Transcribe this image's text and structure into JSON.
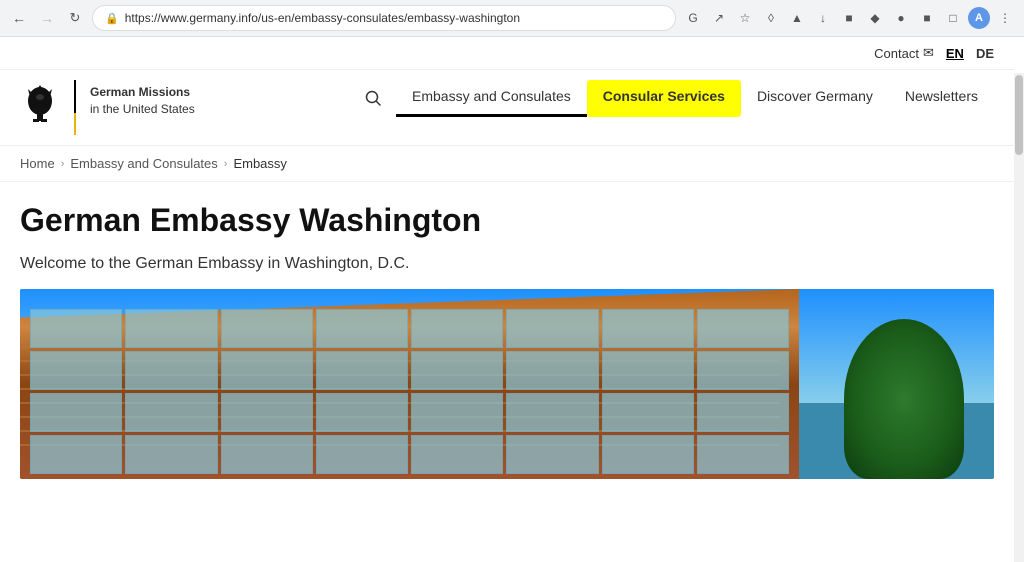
{
  "browser": {
    "url": "https://www.germany.info/us-en/embassy-consulates/embassy-washington",
    "back_disabled": false,
    "forward_disabled": true
  },
  "utility_bar": {
    "contact_label": "Contact",
    "lang_en": "EN",
    "lang_de": "DE",
    "active_lang": "EN"
  },
  "logo": {
    "org_name": "German Missions",
    "org_subtitle": "in the United States"
  },
  "nav": {
    "items": [
      {
        "label": "Embassy and Consulates",
        "active_underline": true,
        "highlighted": false
      },
      {
        "label": "Consular Services",
        "active_underline": false,
        "highlighted": true
      },
      {
        "label": "Discover Germany",
        "active_underline": false,
        "highlighted": false
      },
      {
        "label": "Newsletters",
        "active_underline": false,
        "highlighted": false
      }
    ],
    "search_icon": "🔍"
  },
  "breadcrumb": {
    "items": [
      {
        "label": "Home",
        "link": true
      },
      {
        "label": "Embassy and Consulates",
        "link": true
      },
      {
        "label": "Embassy",
        "link": false
      }
    ]
  },
  "content": {
    "page_title": "German Embassy Washington",
    "page_subtitle": "Welcome to the German Embassy in Washington, D.C."
  }
}
